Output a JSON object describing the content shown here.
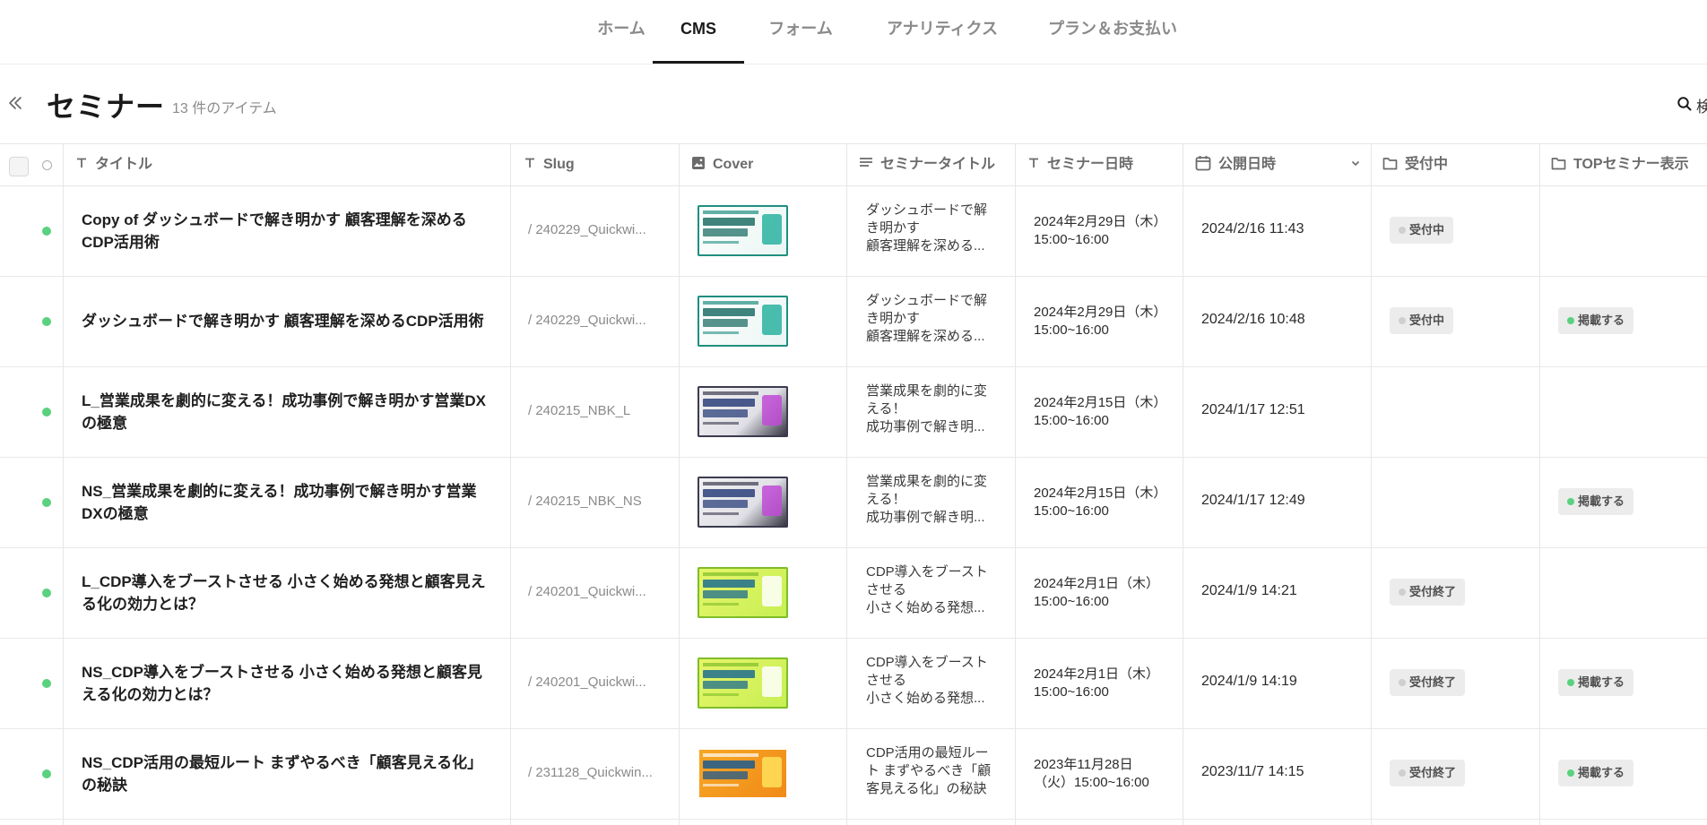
{
  "nav": {
    "tabs": [
      {
        "label": "ホーム",
        "active": false
      },
      {
        "label": "CMS",
        "active": true
      },
      {
        "label": "フォーム",
        "active": false
      },
      {
        "label": "アナリティクス",
        "active": false
      },
      {
        "label": "プラン＆お支払い",
        "active": false
      }
    ]
  },
  "header": {
    "title": "セミナー",
    "item_count": "13 件のアイテム",
    "search_label": "検"
  },
  "table": {
    "columns": [
      {
        "label": "タイトル",
        "icon": "text-type-icon"
      },
      {
        "label": "Slug",
        "icon": "text-type-icon"
      },
      {
        "label": "Cover",
        "icon": "image-icon"
      },
      {
        "label": "セミナータイトル",
        "icon": "paragraph-icon"
      },
      {
        "label": "セミナー日時",
        "icon": "text-type-icon"
      },
      {
        "label": "公開日時",
        "icon": "calendar-icon"
      },
      {
        "label": "受付中",
        "icon": "folder-icon"
      },
      {
        "label": "TOPセミナー表示",
        "icon": "folder-icon"
      }
    ],
    "rows": [
      {
        "title": "Copy of ダッシュボードで解き明かす 顧客理解を深めるCDP活用術",
        "slug": "/ 240229_Quickwi...",
        "cover_theme": "teal",
        "seminar_title": "ダッシュボードで解き明かす\n顧客理解を深める...",
        "seminar_date": "2024年2月29日（木）15:00~16:00",
        "published": "2024/2/16 11:43",
        "status": "受付中",
        "status_color": "#cfcfcf",
        "top": ""
      },
      {
        "title": "ダッシュボードで解き明かす 顧客理解を深めるCDP活用術",
        "slug": "/ 240229_Quickwi...",
        "cover_theme": "teal",
        "seminar_title": "ダッシュボードで解き明かす\n顧客理解を深める...",
        "seminar_date": "2024年2月29日（木）15:00~16:00",
        "published": "2024/2/16 10:48",
        "status": "受付中",
        "status_color": "#cfcfcf",
        "top": "掲載する"
      },
      {
        "title": "L_営業成果を劇的に変える！成功事例で解き明かす営業DXの極意",
        "slug": "/ 240215_NBK_L",
        "cover_theme": "dark",
        "seminar_title": "営業成果を劇的に変える！\n成功事例で解き明...",
        "seminar_date": "2024年2月15日（木）15:00~16:00",
        "published": "2024/1/17 12:51",
        "status": "",
        "status_color": "#cfcfcf",
        "top": ""
      },
      {
        "title": "NS_営業成果を劇的に変える！成功事例で解き明かす営業DXの極意",
        "slug": "/ 240215_NBK_NS",
        "cover_theme": "dark",
        "seminar_title": "営業成果を劇的に変える！\n成功事例で解き明...",
        "seminar_date": "2024年2月15日（木）15:00~16:00",
        "published": "2024/1/17 12:49",
        "status": "",
        "status_color": "#cfcfcf",
        "top": "掲載する"
      },
      {
        "title": "L_CDP導入をブーストさせる 小さく始める発想と顧客見える化の効力とは？",
        "slug": "/ 240201_Quickwi...",
        "cover_theme": "lime",
        "seminar_title": "CDP導入をブーストさせる\n小さく始める発想...",
        "seminar_date": "2024年2月1日（木）15:00~16:00",
        "published": "2024/1/9 14:21",
        "status": "受付終了",
        "status_color": "#cfcfcf",
        "top": ""
      },
      {
        "title": "NS_CDP導入をブーストさせる 小さく始める発想と顧客見える化の効力とは？",
        "slug": "/ 240201_Quickwi...",
        "cover_theme": "lime",
        "seminar_title": "CDP導入をブーストさせる\n小さく始める発想...",
        "seminar_date": "2024年2月1日（木）15:00~16:00",
        "published": "2024/1/9 14:19",
        "status": "受付終了",
        "status_color": "#cfcfcf",
        "top": "掲載する"
      },
      {
        "title": "NS_CDP活用の最短ルート まずやるべき「顧客見える化」の秘訣",
        "slug": "/ 231128_Quickwin...",
        "cover_theme": "orange",
        "seminar_title": "CDP活用の最短ルート まずやるべき「顧客見える化」の秘訣",
        "seminar_date": "2023年11月28日（火）15:00~16:00",
        "published": "2023/11/7 14:15",
        "status": "受付終了",
        "status_color": "#cfcfcf",
        "top": "掲載する"
      }
    ]
  },
  "colors": {
    "published_dot": "#5ad17e",
    "badge_bg": "#ececec",
    "accent": "#1a1a1a"
  }
}
